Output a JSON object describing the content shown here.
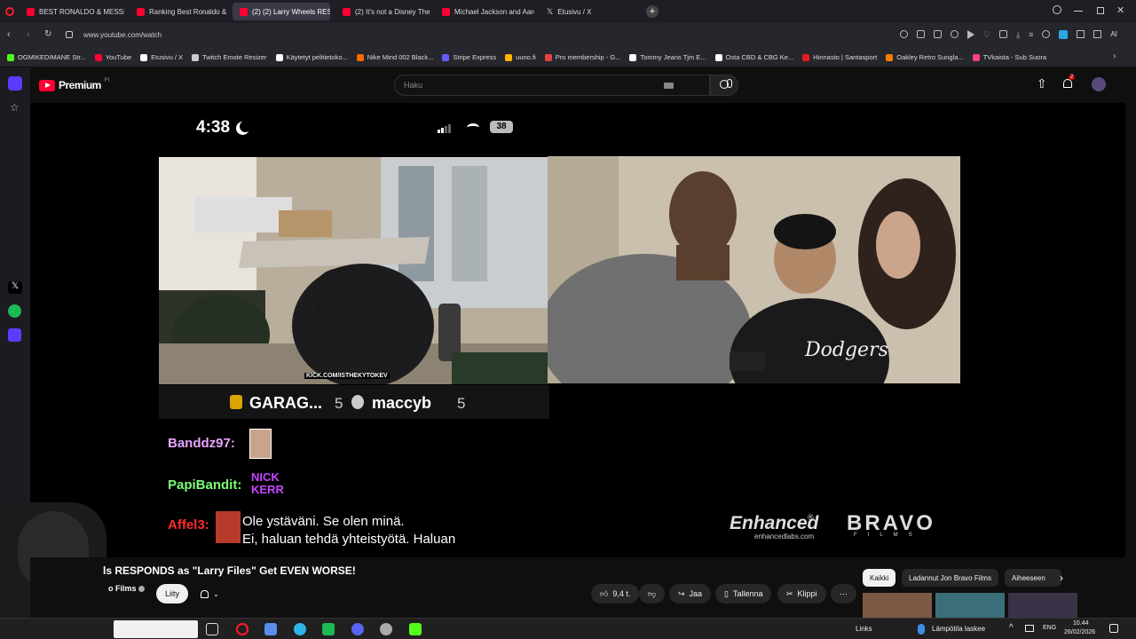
{
  "browser": {
    "tabs": [
      {
        "label": "BEST RONALDO & MESSI",
        "active": false
      },
      {
        "label": "Ranking Best Ronaldo & M",
        "active": false
      },
      {
        "label": "(2) (2) Larry Wheels RESP",
        "active": true
      },
      {
        "label": "(2) It's not a Disney Theor",
        "active": false
      },
      {
        "label": "Michael Jackson and Aaro",
        "active": false
      },
      {
        "label": "Etusivu / X",
        "active": false
      }
    ],
    "url": "www.youtube.com/watch",
    "bookmarks": [
      {
        "label": "OGMIKEDIMANE Str...",
        "color": "#53fc18"
      },
      {
        "label": "YouTube",
        "color": "#ff0033"
      },
      {
        "label": "Etusivu / X",
        "color": "#ffffff"
      },
      {
        "label": "Twitch Emote Resizer",
        "color": "#cccccc"
      },
      {
        "label": "Käytetyt pelitietoko...",
        "color": "#ffffff"
      },
      {
        "label": "Nike Mind 002 Black...",
        "color": "#ff6a00"
      },
      {
        "label": "Stripe Express",
        "color": "#635bff"
      },
      {
        "label": "uuno.fi",
        "color": "#ffb400"
      },
      {
        "label": "Pro membership - G...",
        "color": "#e34242"
      },
      {
        "label": "Tommy Jeans Tjm E...",
        "color": "#ffffff"
      },
      {
        "label": "Osta CBD & CBG Ke...",
        "color": "#ffffff"
      },
      {
        "label": "Hinnasto | Santasport",
        "color": "#e31b23"
      },
      {
        "label": "Oakley Retro Sungla...",
        "color": "#f57c00"
      },
      {
        "label": "TVkaista - Sub Suora",
        "color": "#ff4081"
      }
    ]
  },
  "youtube": {
    "logo_label": "Premium",
    "logo_sup": "FI",
    "search_placeholder": "Haku",
    "notification_count": "2"
  },
  "video": {
    "status_time": "4:38",
    "battery": "38",
    "kick_watermark": "KICK.COM/ISTHEKYTOKEV",
    "scoreboard": {
      "team1": "GARAG...",
      "score1": "5",
      "team2": "maccyb",
      "score2": "5"
    },
    "chat": [
      {
        "user": "Banddz97:",
        "color": "#e8a3ff"
      },
      {
        "user": "PapiBandit:",
        "color": "#7dff7a"
      },
      {
        "user": "Affel3:",
        "color": "#ff2a2a"
      }
    ],
    "emote_text": "NICK KERR",
    "subtitle_line1": "Ole ystäväni. Se olen minä.",
    "subtitle_line2": "Ei, haluan tehdä yhteistyötä. Haluan",
    "sponsor_brand": "Enhanced",
    "sponsor_url": "enhancedlabs.com",
    "sponsor_brand2": "BRAVO",
    "sponsor_brand2_sub": "FILMS"
  },
  "meta": {
    "title": "ls RESPONDS as \"Larry Files\" Get EVEN WORSE!",
    "channel": "o Films",
    "join_label": "Liity",
    "like_count": "9,4 t.",
    "share_label": "Jaa",
    "save_label": "Tallenna",
    "clip_label": "Klippi",
    "chips": [
      "Kaikki",
      "Ladannut Jon Bravo Films",
      "Aiheeseen"
    ]
  },
  "taskbar": {
    "links_label": "Links",
    "weather": "Lämpötila laskee",
    "lang": "ENG",
    "time": "10.44",
    "date": "26/02/2026"
  }
}
